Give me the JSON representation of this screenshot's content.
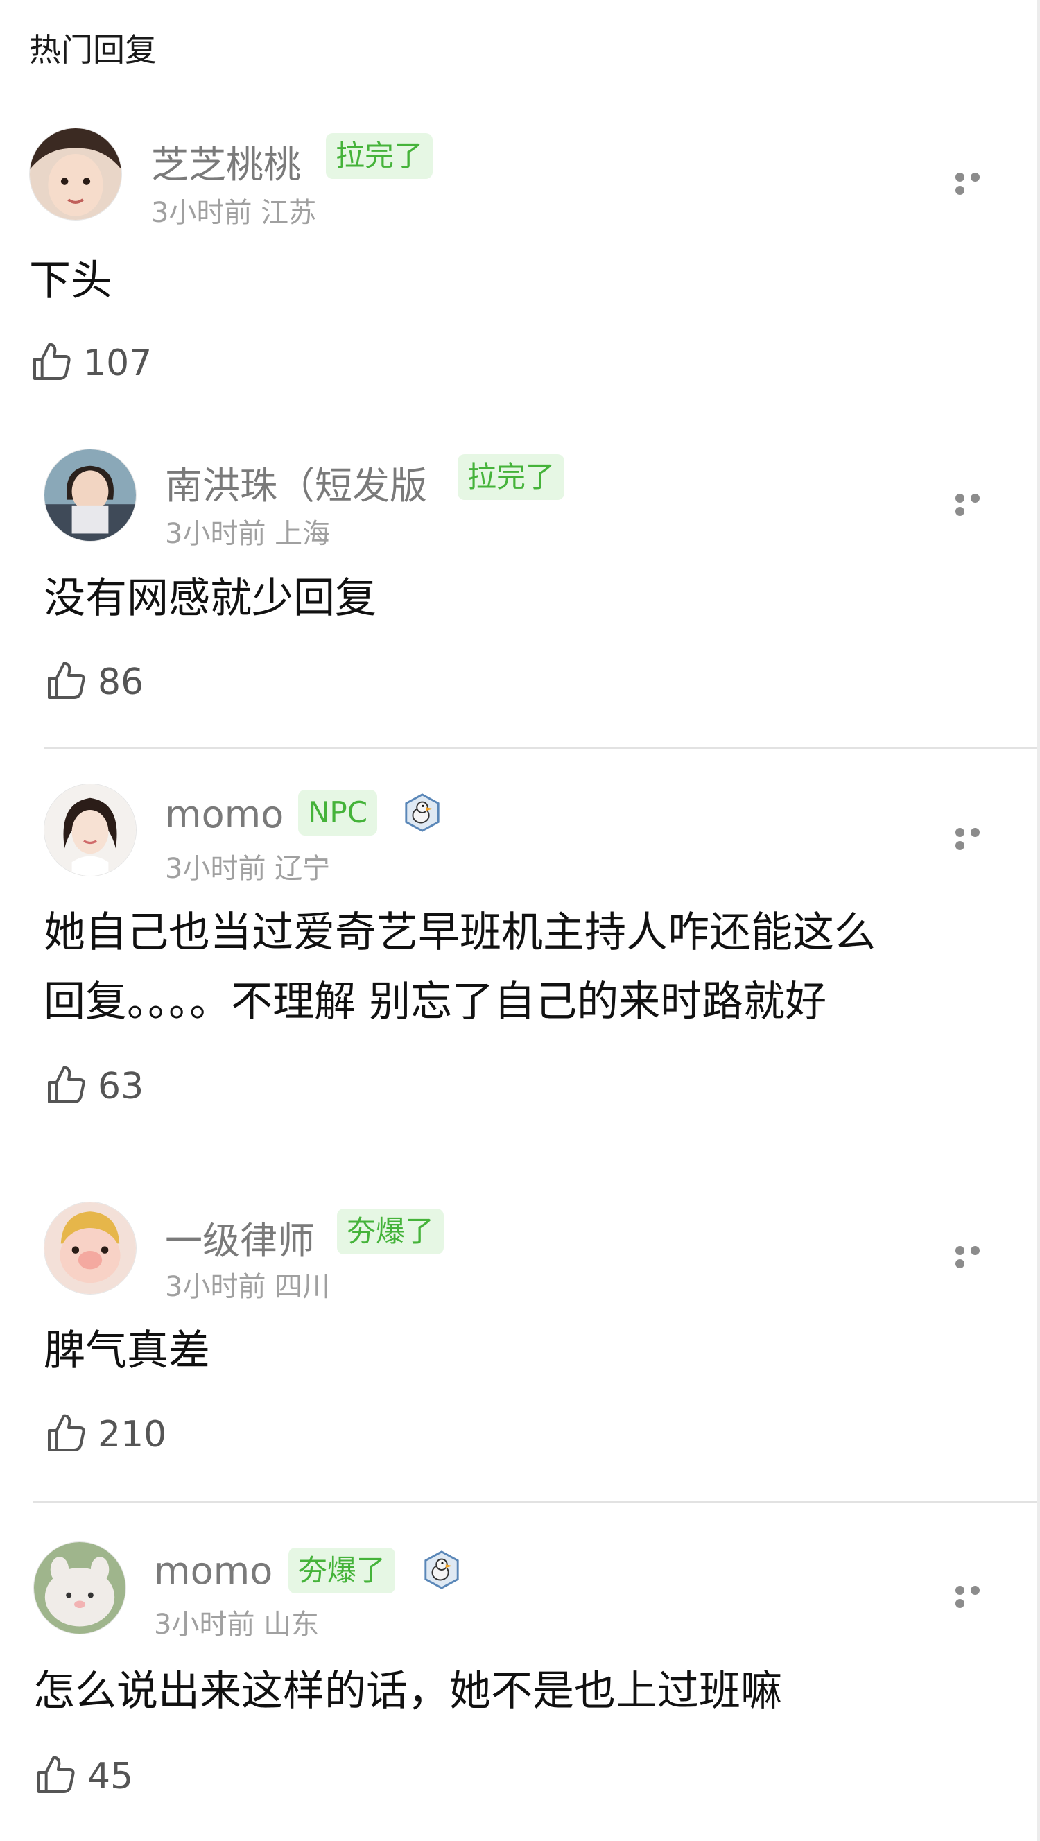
{
  "section_title": "热门回复",
  "icons": {
    "more": "more-dots-icon",
    "like": "thumbs-up-icon",
    "badge": "duck-badge-icon"
  },
  "colors": {
    "tag_bg": "#e6f7e4",
    "tag_text": "#45b33a",
    "username": "#7a7a7a",
    "meta": "#a0a0a0"
  },
  "comments": [
    {
      "username": "芝芝桃桃",
      "tag": "拉完了",
      "time": "3小时前",
      "location": "江苏",
      "lines": [
        "下头"
      ],
      "likes": "107"
    },
    {
      "username": "南洪珠（短发版",
      "tag": "拉完了",
      "time": "3小时前",
      "location": "上海",
      "lines": [
        "没有网感就少回复"
      ],
      "likes": "86"
    },
    {
      "username": "momo",
      "tag": "NPC",
      "time": "3小时前",
      "location": "辽宁",
      "lines": [
        "她自己也当过爱奇艺早班机主持人咋还能这么",
        "回复。。。。不理解 别忘了自己的来时路就好"
      ],
      "likes": "63"
    },
    {
      "username": "一级律师",
      "tag": "夯爆了",
      "time": "3小时前",
      "location": "四川",
      "lines": [
        "脾气真差"
      ],
      "likes": "210"
    },
    {
      "username": "momo",
      "tag": "夯爆了",
      "time": "3小时前",
      "location": "山东",
      "lines": [
        "怎么说出来这样的话，她不是也上过班嘛"
      ],
      "likes": "45"
    }
  ]
}
